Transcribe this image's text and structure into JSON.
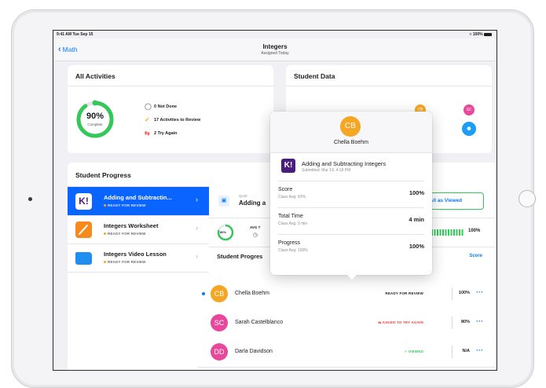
{
  "status_bar": {
    "time": "9:41 AM  Tue Sep 15",
    "battery": "100%"
  },
  "nav": {
    "back_label": "Math",
    "title": "Integers",
    "subtitle": "Assigned Today"
  },
  "all_activities": {
    "title": "All Activities",
    "complete_percent": "90%",
    "complete_label": "Complete",
    "progress_fraction": 0.9,
    "stats": [
      {
        "icon": "not-done-icon",
        "text": "0 Not Done"
      },
      {
        "icon": "checkmark-icon",
        "text": "17 Activities to Review"
      },
      {
        "icon": "retry-icon",
        "text": "2 Try Again"
      }
    ]
  },
  "student_data": {
    "title": "Student Data",
    "avatars": [
      "CB",
      "SC"
    ]
  },
  "student_progress": {
    "title": "Student Progress",
    "items": [
      {
        "name": "Adding and Subtractin...",
        "status": "READY FOR REVIEW",
        "active": true
      },
      {
        "name": "Integers Worksheet",
        "status": "READY FOR REVIEW",
        "active": false
      },
      {
        "name": "Integers Video Lesson",
        "status": "READY FOR REVIEW",
        "active": false
      }
    ]
  },
  "detail": {
    "quiz_tag": "QUIZ",
    "quiz_title": "Adding a",
    "mark_viewed_button": "rk All as Viewed",
    "avg_label": "AVG T",
    "progress_mini_pct": "80%",
    "progress_bar_pct": "100%",
    "student_progress_title": "Student Progres",
    "score_header": "Score"
  },
  "students": [
    {
      "initials": "CB",
      "name": "Chella Boehm",
      "status": "READY FOR REVIEW",
      "score": "100%",
      "color": "#f5a623",
      "unread": true
    },
    {
      "initials": "SC",
      "name": "Sarah Castelblanco",
      "status": "ASKED TO TRY AGAIN",
      "score": "80%",
      "color": "#e8479b",
      "unread": false
    },
    {
      "initials": "DD",
      "name": "Darla Davidson",
      "status": "VIEWED",
      "score": "N/A",
      "color": "#e8479b",
      "unread": false
    }
  ],
  "popover": {
    "initials": "CB",
    "name": "Chella Boehm",
    "activity_title": "Adding and Subtracting Integers",
    "activity_sub": "Submitted: Mar 19, 4:18 PM",
    "metrics": [
      {
        "label": "Score",
        "sub": "Class Avg: 92%",
        "value": "100%"
      },
      {
        "label": "Total Time",
        "sub": "Class Avg: 3 min",
        "value": "4 min"
      },
      {
        "label": "Progress",
        "sub": "Class Avg: 100%",
        "value": "100%"
      }
    ]
  },
  "colors": {
    "accent": "#0a7aff",
    "green": "#34c759",
    "orange": "#f5a623",
    "pink": "#e8479b",
    "selected": "#0a64ff"
  }
}
